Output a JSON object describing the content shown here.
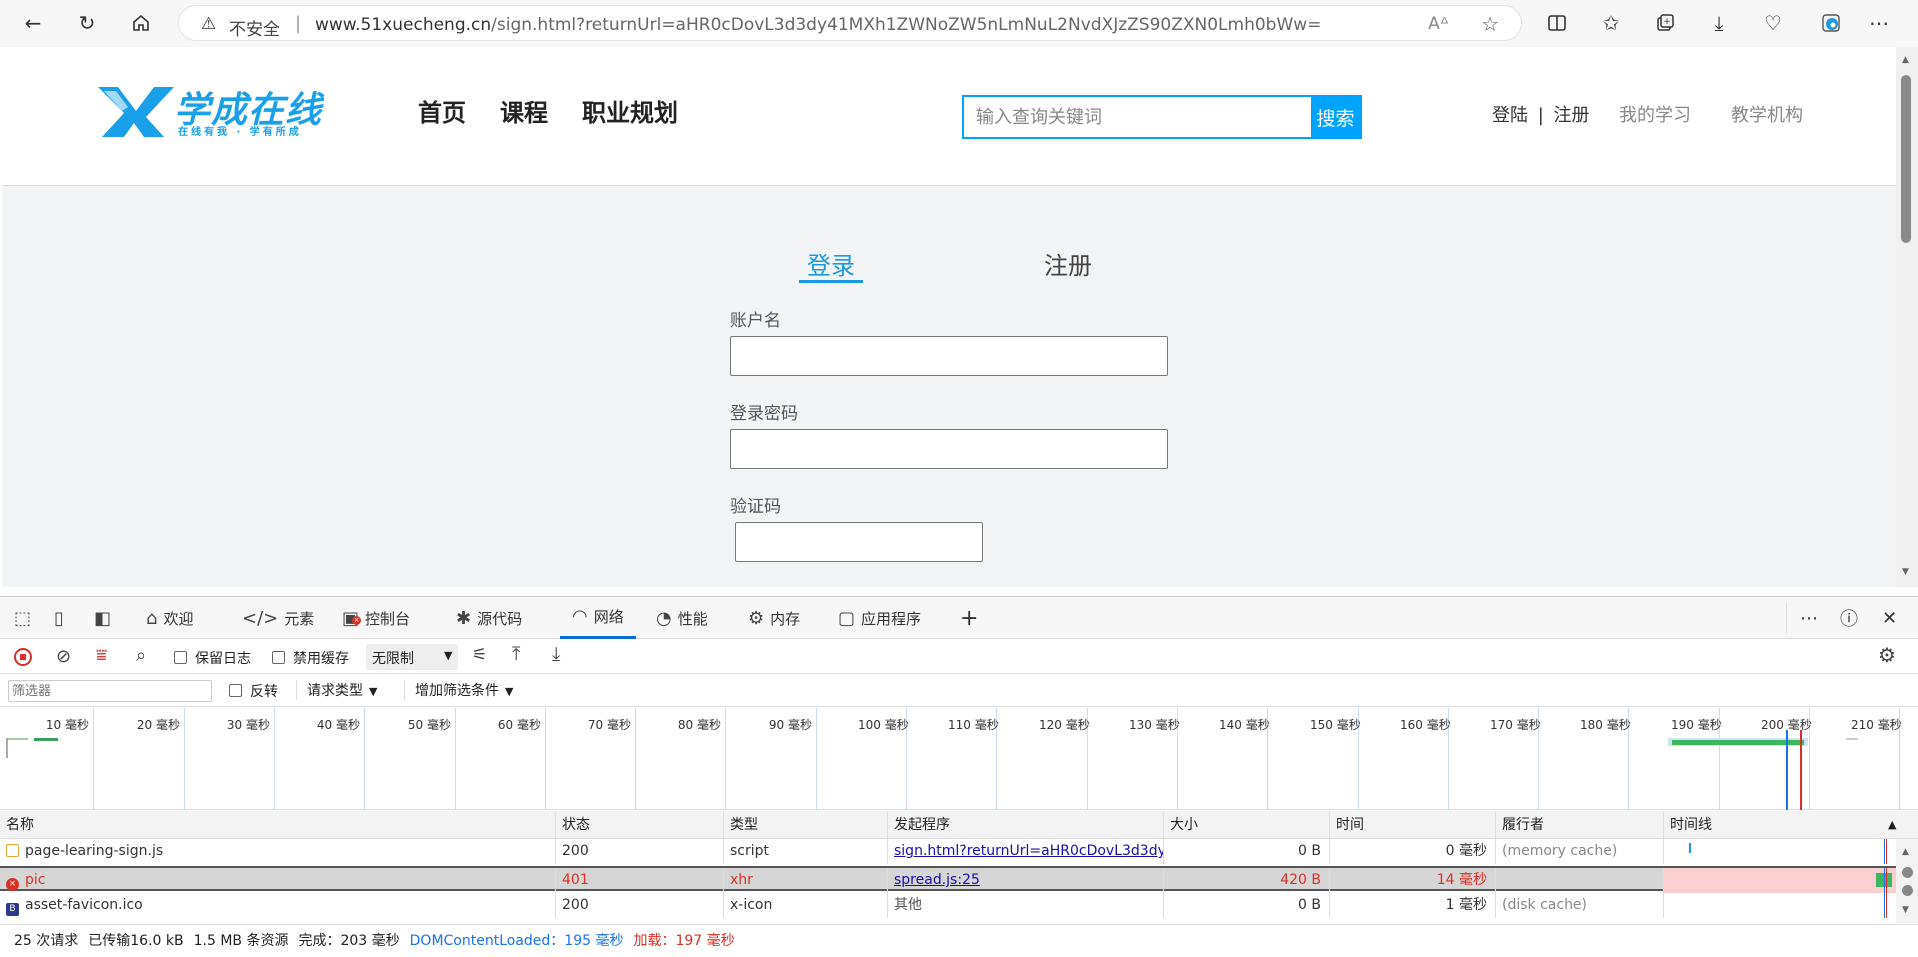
{
  "browser": {
    "security_label": "不安全",
    "url_host": "www.51xuecheng.cn",
    "url_path": "/sign.html?returnUrl=aHR0cDovL3d3dy41MXh1ZWNoZW5nLmNuL2NvdXJzZS90ZXN0Lmh0bWw=",
    "read_aloud": "A"
  },
  "site": {
    "logo_main": "学成在线",
    "logo_sub": "在线有我 · 学有所成",
    "nav": [
      "首页",
      "课程",
      "职业规划"
    ],
    "search_placeholder": "输入查询关键词",
    "search_button": "搜索",
    "login": "登陆",
    "divider": "|",
    "register": "注册",
    "my_learning": "我的学习",
    "institution": "教学机构"
  },
  "login_form": {
    "tab_login": "登录",
    "tab_register": "注册",
    "account_label": "账户名",
    "password_label": "登录密码",
    "captcha_label": "验证码"
  },
  "devtools": {
    "tabs": [
      "欢迎",
      "元素",
      "控制台",
      "源代码",
      "网络",
      "性能",
      "内存",
      "应用程序"
    ],
    "active_tab": "网络",
    "preserve_log": "保留日志",
    "disable_cache": "禁用缓存",
    "throttle": "无限制",
    "filter_placeholder": "筛选器",
    "invert": "反转",
    "request_type": "请求类型",
    "more_filters": "增加筛选条件",
    "timeline_ticks": [
      "10 毫秒",
      "20 毫秒",
      "30 毫秒",
      "40 毫秒",
      "50 毫秒",
      "60 毫秒",
      "70 毫秒",
      "80 毫秒",
      "90 毫秒",
      "100 毫秒",
      "110 毫秒",
      "120 毫秒",
      "130 毫秒",
      "140 毫秒",
      "150 毫秒",
      "160 毫秒",
      "170 毫秒",
      "180 毫秒",
      "190 毫秒",
      "200 毫秒",
      "210 毫秒"
    ],
    "columns": [
      "名称",
      "状态",
      "类型",
      "发起程序",
      "大小",
      "时间",
      "履行者",
      "时间线"
    ],
    "rows": [
      {
        "name": "page-learing-sign.js",
        "status": "200",
        "type": "script",
        "initiator": "sign.html?returnUrl=aHR0cDovL3d3dy...",
        "size": "0 B",
        "time": "0 毫秒",
        "fulfilled": "(memory cache)",
        "icon": "script-file-icon",
        "error": false
      },
      {
        "name": "pic",
        "status": "401",
        "type": "xhr",
        "initiator": "spread.js:25",
        "size": "420 B",
        "time": "14 毫秒",
        "fulfilled": "",
        "icon": "error-icon",
        "error": true
      },
      {
        "name": "asset-favicon.ico",
        "status": "200",
        "type": "x-icon",
        "initiator": "其他",
        "size": "0 B",
        "time": "1 毫秒",
        "fulfilled": "(disk cache)",
        "icon": "favicon-icon",
        "error": false
      }
    ],
    "status": {
      "requests": "25 次请求",
      "transferred": "已传输16.0 kB",
      "resources": "1.5 MB 条资源",
      "finish": "完成：203 毫秒",
      "dcl": "DOMContentLoaded：195 毫秒",
      "load": "加载：197 毫秒"
    }
  }
}
